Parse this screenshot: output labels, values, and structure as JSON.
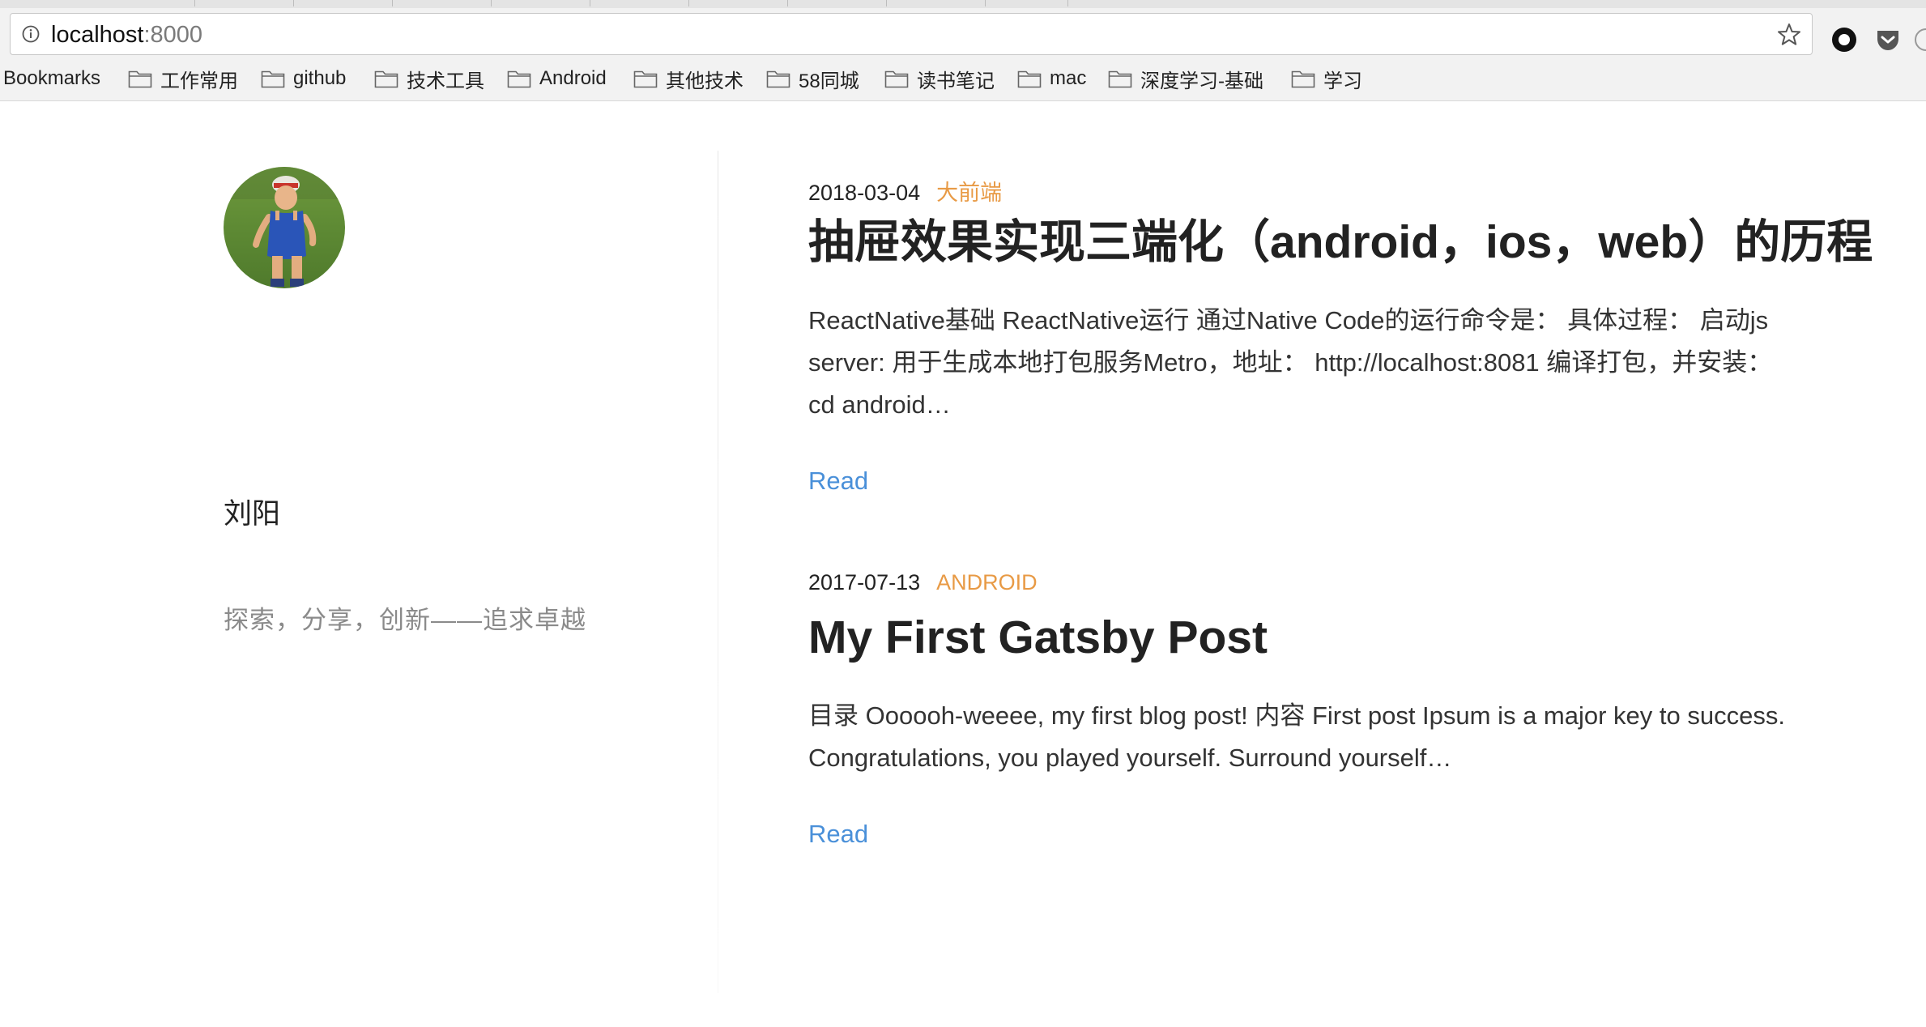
{
  "browser": {
    "url_host": "localhost",
    "url_port": ":8000",
    "bookmarks_label": "Bookmarks",
    "bookmark_folders": [
      "工作常用",
      "github",
      "技术工具",
      "Android",
      "其他技术",
      "58同城",
      "读书笔记",
      "mac",
      "深度学习-基础",
      "学习"
    ]
  },
  "sidebar": {
    "author_name": "刘阳",
    "tagline": "探索，分享，创新——追求卓越"
  },
  "posts": [
    {
      "date": "2018-03-04",
      "category": "大前端",
      "title": "抽屉效果实现三端化（android，ios，web）的历程",
      "excerpt_lines": [
        "ReactNative基础 ReactNative运行 通过Native Code的运行命令是：  具体过程：  启动js",
        "server: 用于生成本地打包服务Metro，地址：  http://localhost:8081 编译打包，并安装：",
        "cd android…"
      ],
      "read_label": "Read"
    },
    {
      "date": "2017-07-13",
      "category": "ANDROID",
      "title": "My First Gatsby Post",
      "excerpt_lines": [
        "目录 Oooooh-weeee, my first blog post! 内容 First post Ipsum is a major key to success.",
        "Congratulations, you played yourself. Surround yourself…"
      ],
      "read_label": "Read"
    }
  ],
  "colors": {
    "category": "#e89a45",
    "link": "#4a90d9",
    "text": "#222222",
    "muted": "#8a8a8a"
  }
}
